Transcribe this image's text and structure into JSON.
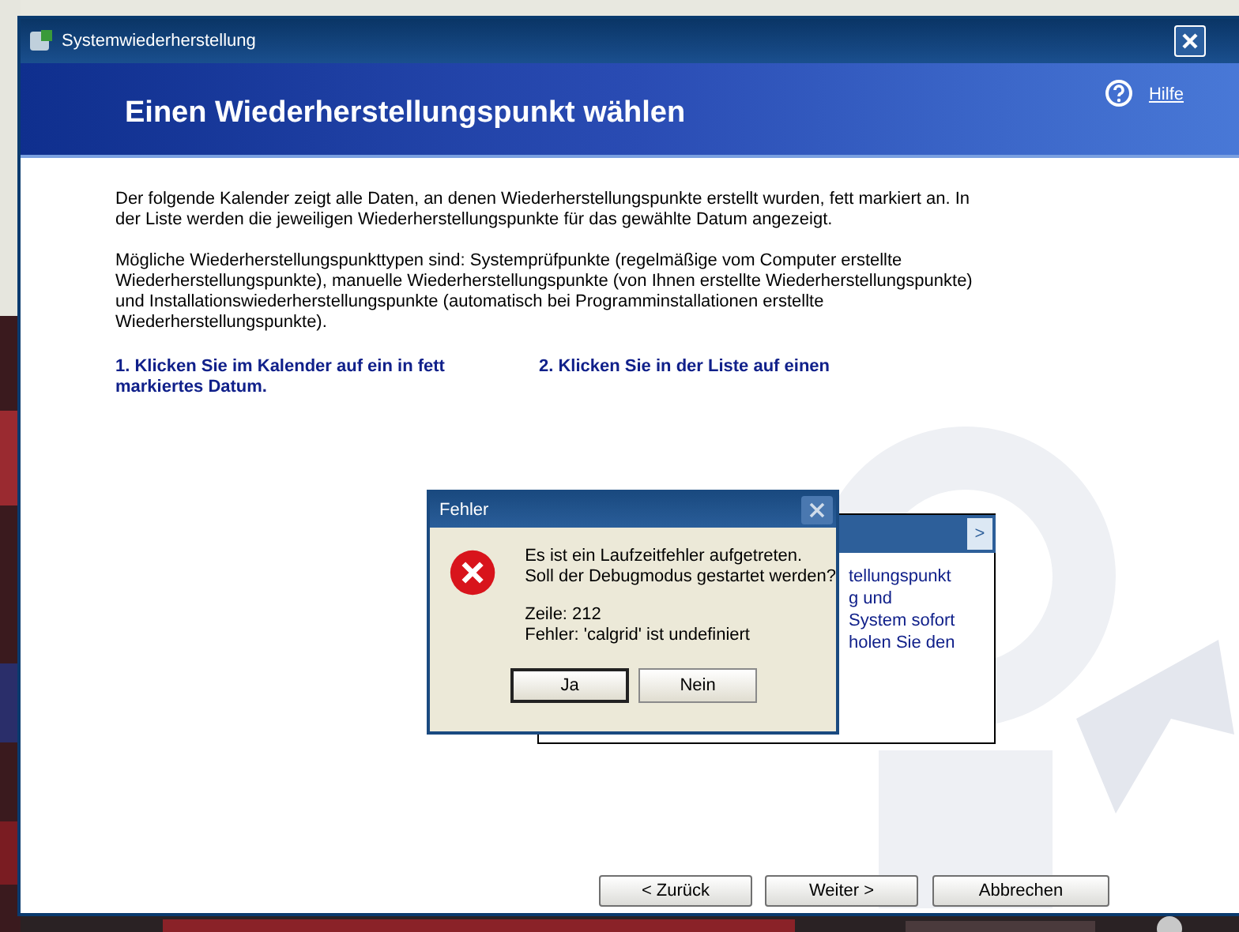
{
  "window": {
    "title": "Systemwiederherstellung"
  },
  "header": {
    "title": "Einen Wiederherstellungspunkt wählen",
    "help_link": "Hilfe"
  },
  "intro": [
    "Der folgende Kalender zeigt alle Daten, an denen Wiederherstellungspunkte erstellt wurden, fett markiert an. In der Liste werden die jeweiligen Wiederherstellungspunkte für das gewählte Datum angezeigt.",
    "Mögliche Wiederherstellungspunkttypen sind: Systemprüfpunkte (regelmäßige vom Computer erstellte Wiederherstellungspunkte), manuelle Wiederherstellungspunkte (von Ihnen erstellte Wiederherstellungspunkte) und Installationswiederherstellungspunkte (automatisch bei Programminstallationen erstellte Wiederherstellungspunkte)."
  ],
  "steps": [
    "1. Klicken Sie im Kalender auf ein in fett markiertes Datum.",
    "2. Klicken Sie in der Liste auf einen"
  ],
  "list_panel": {
    "next_button": ">",
    "lines": [
      "tellungspunkt",
      "g und",
      "System sofort",
      "holen Sie den"
    ]
  },
  "dialog": {
    "title": "Fehler",
    "message": [
      "Es ist ein Laufzeitfehler aufgetreten.",
      "Soll der Debugmodus gestartet werden?"
    ],
    "details": [
      "Zeile: 212",
      "Fehler: 'calgrid' ist undefiniert"
    ],
    "buttons": [
      {
        "label": "Ja",
        "selected": true
      },
      {
        "label": "Nein",
        "selected": false
      }
    ]
  },
  "buttons": [
    "< Zurück",
    "Weiter >",
    "Abbrechen"
  ]
}
